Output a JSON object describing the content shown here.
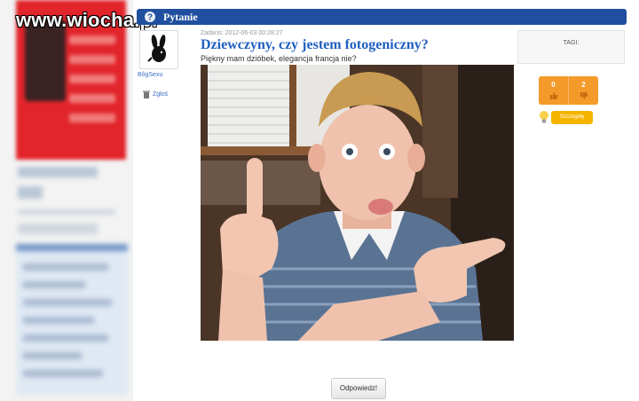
{
  "watermark": {
    "text": "www.wiocha.pl"
  },
  "header": {
    "title": "Pytanie",
    "icon": "question-icon"
  },
  "author": {
    "username": "BôgSexu",
    "avatar_icon": "bunny-logo-icon",
    "report_label": "Zgłoś",
    "report_icon": "trash-icon"
  },
  "question": {
    "asked": "Zadano: 2012-06-03 00:28:27",
    "title": "Dziewczyny, czy jestem fotogeniczny?",
    "body": "Piękny mam dzióbek, elegancja francja nie?"
  },
  "tags": {
    "label": "TAGI:"
  },
  "votes": {
    "up": "0",
    "down": "2",
    "up_icon": "thumb-up-icon",
    "down_icon": "thumb-down-icon"
  },
  "details": {
    "label": "Szczegóły",
    "icon": "lightbulb-icon"
  },
  "answer": {
    "label": "Odpowiedz!"
  },
  "colors": {
    "header": "#1f4f9e",
    "link": "#1f5fc0",
    "vote_box": "#f39a2a",
    "details": "#f4b400",
    "banner": "#e2242b"
  }
}
